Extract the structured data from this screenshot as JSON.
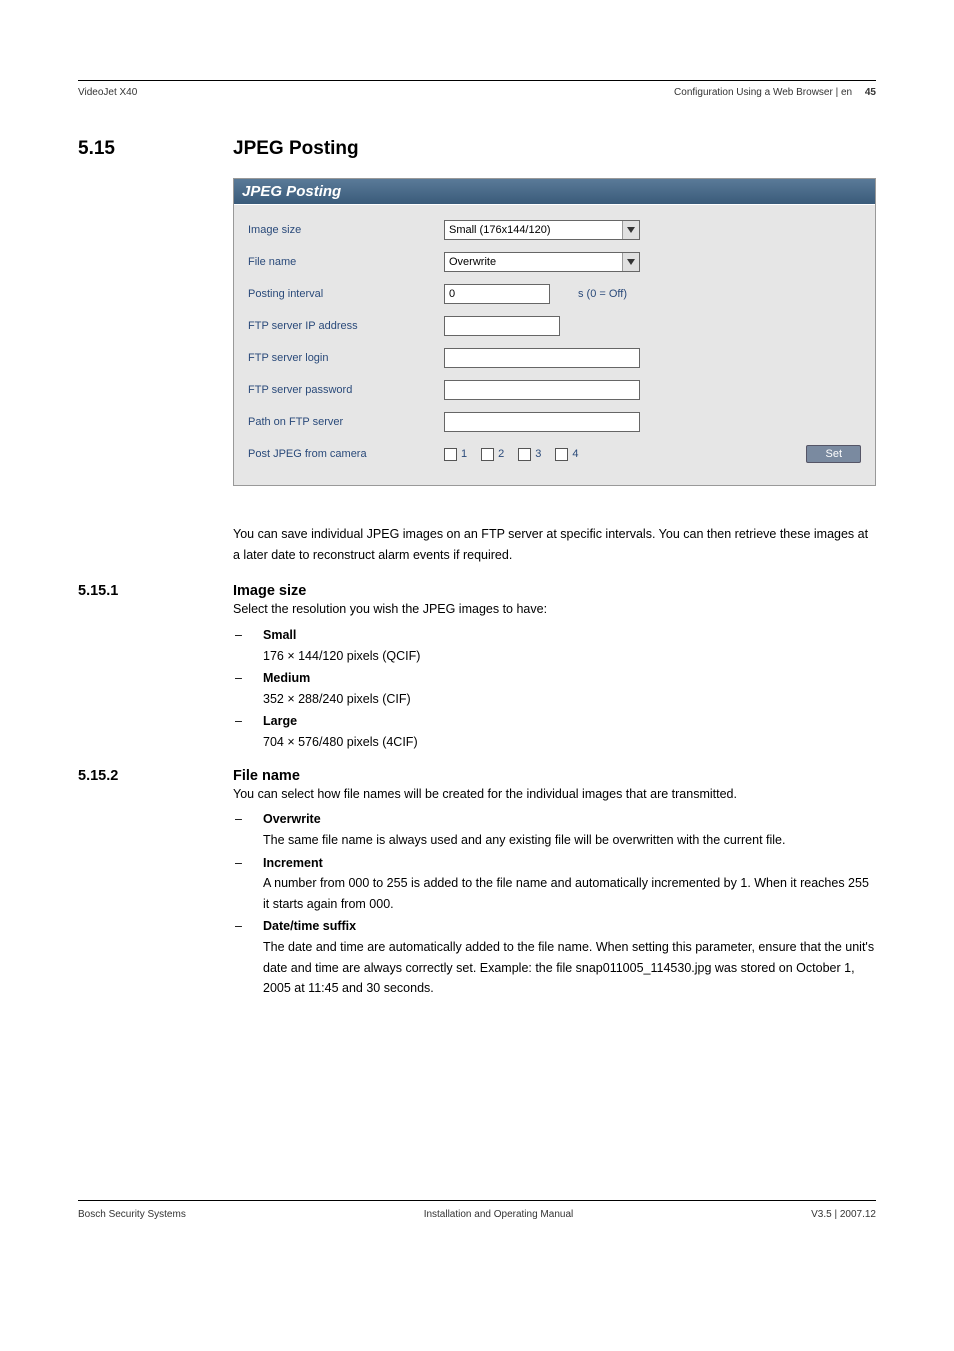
{
  "header": {
    "left": "VideoJet X40",
    "right": "Configuration Using a Web Browser | en",
    "page": "45"
  },
  "section": {
    "num": "5.15",
    "title": "JPEG Posting"
  },
  "panel": {
    "title": "JPEG Posting",
    "rows": {
      "image_size": {
        "label": "Image size",
        "value": "Small (176x144/120)"
      },
      "file_name": {
        "label": "File name",
        "value": "Overwrite"
      },
      "interval": {
        "label": "Posting interval",
        "value": "0",
        "suffix": "s (0 = Off)"
      },
      "ftp_ip": {
        "label": "FTP server IP address",
        "value": ""
      },
      "ftp_login": {
        "label": "FTP server login",
        "value": ""
      },
      "ftp_pass": {
        "label": "FTP server password",
        "value": ""
      },
      "ftp_path": {
        "label": "Path on FTP server",
        "value": ""
      },
      "post_from": {
        "label": "Post JPEG from camera",
        "c1": "1",
        "c2": "2",
        "c3": "3",
        "c4": "4"
      }
    },
    "set_button": "Set"
  },
  "intro": "You can save individual JPEG images on an FTP server at specific intervals. You can then retrieve these images at a later date to reconstruct alarm events if required.",
  "sub1": {
    "num": "5.15.1",
    "title": "Image size",
    "lead": "Select the resolution you wish the JPEG images to have:",
    "items": [
      {
        "label": "Small",
        "desc": "176 × 144/120 pixels (QCIF)"
      },
      {
        "label": "Medium",
        "desc": "352 × 288/240 pixels (CIF)"
      },
      {
        "label": "Large",
        "desc": "704 × 576/480 pixels (4CIF)"
      }
    ]
  },
  "sub2": {
    "num": "5.15.2",
    "title": "File name",
    "lead": "You can select how file names will be created for the individual images that are transmitted.",
    "items": [
      {
        "label": "Overwrite",
        "desc": "The same file name is always used and any existing file will be overwritten with the current file."
      },
      {
        "label": "Increment",
        "desc": "A number from 000 to 255 is added to the file name and automatically incremented by 1. When it reaches 255 it starts again from 000."
      },
      {
        "label": "Date/time suffix",
        "desc": "The date and time are automatically added to the file name. When setting this parameter, ensure that the unit's date and time are always correctly set. Example: the file snap011005_114530.jpg was stored on October 1, 2005 at 11:45 and 30 seconds."
      }
    ]
  },
  "footer": {
    "left": "Bosch Security Systems",
    "center": "Installation and Operating Manual",
    "right": "V3.5 | 2007.12"
  }
}
